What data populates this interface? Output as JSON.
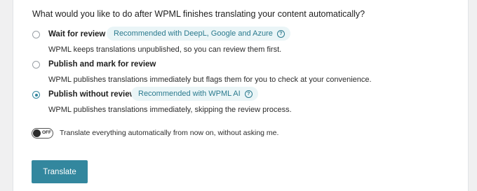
{
  "question": "What would you like to do after WPML finishes translating your content automatically?",
  "options": [
    {
      "title": "Wait for review",
      "badge": "Recommended with DeepL, Google and Azure",
      "description": "WPML keeps translations unpublished, so you can review them first.",
      "selected": false
    },
    {
      "title": "Publish and mark for review",
      "description": "WPML publishes translations immediately but flags them for you to check at your convenience.",
      "selected": false
    },
    {
      "title": "Publish without review",
      "badge": "Recommended with WPML AI",
      "description": "WPML publishes translations immediately, skipping the review process.",
      "selected": true
    }
  ],
  "toggle": {
    "state_label": "OFF",
    "label": "Translate everything automatically from now on, without asking me."
  },
  "button": {
    "label": "Translate"
  },
  "icons": {
    "info": "question-circle-icon"
  },
  "colors": {
    "accent": "#33879e",
    "badge_bg": "#eaf5f7",
    "badge_text": "#2b7a8e"
  }
}
